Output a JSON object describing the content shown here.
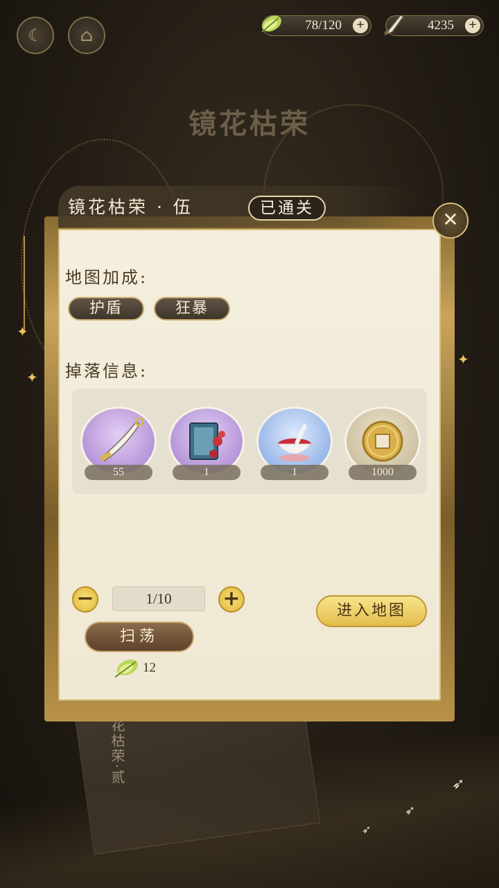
{
  "top_bar": {
    "stamina": {
      "value": "78/120",
      "icon": "leaf-icon",
      "plus": "+"
    },
    "currency": {
      "value": "4235",
      "icon": "dagger-icon",
      "plus": "+"
    }
  },
  "background_title": "镜花枯荣",
  "panel": {
    "stage_name": "镜花枯荣 · 伍",
    "status_badge": "已通关",
    "close_icon": "✕",
    "map_bonus_label": "地图加成:",
    "buffs": [
      "护盾",
      "狂暴"
    ],
    "drops_label": "掉落信息:",
    "drops": [
      {
        "name": "dagger",
        "count": "55"
      },
      {
        "name": "book",
        "count": "1"
      },
      {
        "name": "bowl",
        "count": "1"
      },
      {
        "name": "coin",
        "count": "1000"
      }
    ],
    "minus_label": "−",
    "plus_label": "+",
    "sweep_count": "1/10",
    "enter_map_label": "进入地图",
    "sweep_label": "扫荡",
    "sweep_cost": "12"
  },
  "under_card_title": "花枯荣·贰",
  "colors": {
    "accent_gold": "#e2bd4c",
    "panel_bg": "#f4eedd",
    "dark_badge": "#2c241a"
  }
}
